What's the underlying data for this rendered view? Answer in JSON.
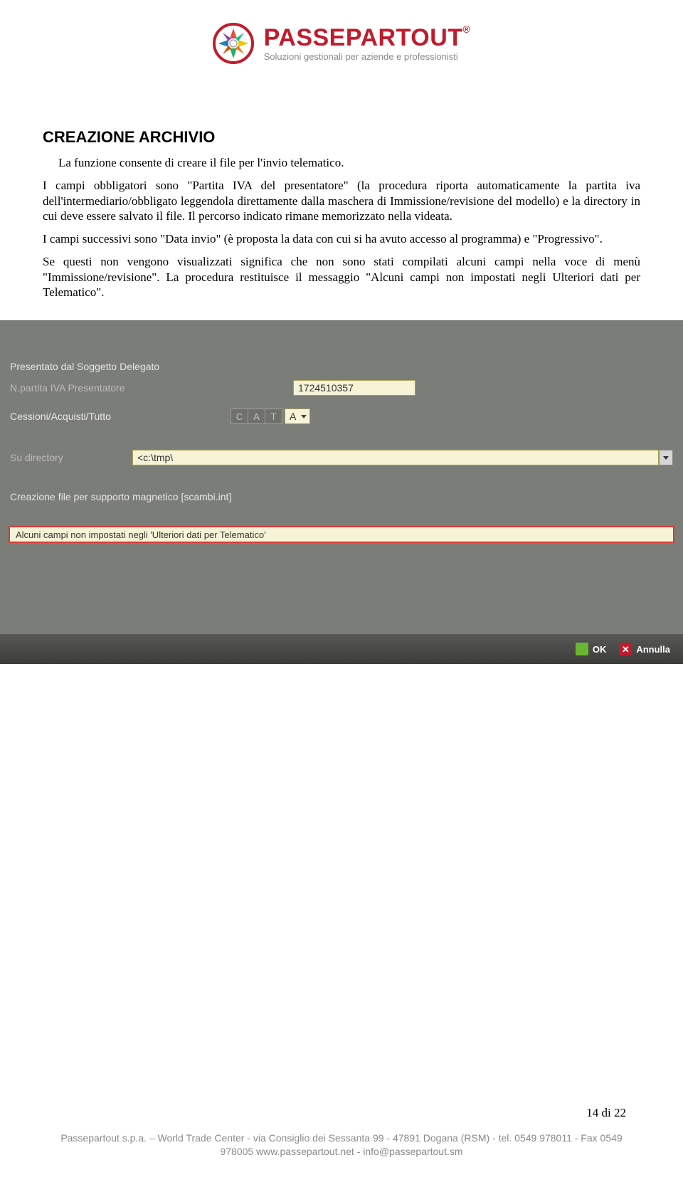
{
  "logo": {
    "word": "PASSEPARTOUT",
    "reg": "®",
    "tagline": "Soluzioni gestionali per aziende e professionisti"
  },
  "section": {
    "title": "CREAZIONE ARCHIVIO",
    "p1": "La funzione consente di creare il file per l'invio telematico.",
    "p2": "I campi obbligatori sono \"Partita IVA del presentatore\" (la procedura riporta automaticamente la partita iva dell'intermediario/obbligato leggendola direttamente dalla maschera di Immissione/revisione del modello) e la directory in cui deve essere salvato il file. Il percorso indicato rimane memorizzato nella videata.",
    "p3": "I campi successivi sono \"Data invio\" (è proposta la data con cui si ha avuto accesso al programma) e \"Progressivo\".",
    "p4": "Se questi non vengono visualizzati significa che non sono stati compilati alcuni campi nella voce di menù \"Immissione/revisione\". La procedura restituisce il messaggio \"Alcuni campi non impostati negli Ulteriori dati per Telematico\"."
  },
  "screenshot": {
    "presentato_label": "Presentato dal Soggetto Delegato",
    "iva_label": "N.partita IVA Presentatore",
    "iva_value": "1724510357",
    "cat_label": "Cessioni/Acquisti/Tutto",
    "cat_c": "C",
    "cat_a": "A",
    "cat_t": "T",
    "cat_selected": "A",
    "dir_label": "Su directory",
    "dir_value": "<c:\\tmp\\",
    "creazione_label": "Creazione file per supporto magnetico [scambi.int]",
    "error_text": "Alcuni campi non impostati negli 'Ulteriori dati per Telematico'",
    "ok_label": "OK",
    "annulla_label": "Annulla"
  },
  "page_number": "14 di 22",
  "footer": {
    "line1": "Passepartout s.p.a. – World Trade Center - via Consiglio dei Sessanta 99 - 47891 Dogana (RSM) - tel. 0549 978011 - Fax 0549",
    "line2": "978005 www.passepartout.net - info@passepartout.sm"
  }
}
